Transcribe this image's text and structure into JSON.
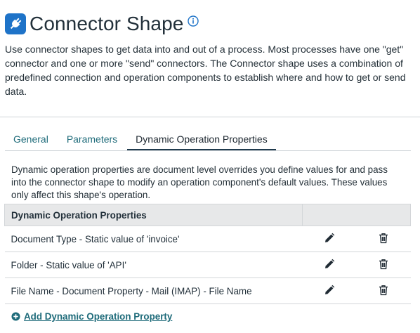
{
  "header": {
    "title": "Connector Shape",
    "icon": "plug-icon",
    "info_icon": "info-icon",
    "accent_color": "#1e73c8"
  },
  "description": "Use connector shapes to get data into and out of a process. Most processes have one \"get\" connector and one or more \"send\" connectors. The Connector shape uses a combination of predefined connection and operation components to establish where and how to get or send data.",
  "tabs": [
    {
      "label": "General",
      "active": false
    },
    {
      "label": "Parameters",
      "active": false
    },
    {
      "label": "Dynamic Operation Properties",
      "active": true
    }
  ],
  "tab_description": "Dynamic operation properties are document level overrides you define values for and pass into the connector shape to modify an operation component's default values. These values only affect this shape's operation.",
  "table": {
    "header": "Dynamic Operation Properties",
    "rows": [
      {
        "label": "Document Type - Static value of 'invoice'",
        "edit_icon": "pencil-icon",
        "delete_icon": "trash-icon"
      },
      {
        "label": "Folder - Static value of 'API'",
        "edit_icon": "pencil-icon",
        "delete_icon": "trash-icon"
      },
      {
        "label": "File Name - Document Property - Mail (IMAP) - File Name",
        "edit_icon": "pencil-icon",
        "delete_icon": "trash-icon"
      }
    ]
  },
  "add_link": {
    "label": "Add Dynamic Operation Property",
    "icon": "plus-circle-icon"
  }
}
